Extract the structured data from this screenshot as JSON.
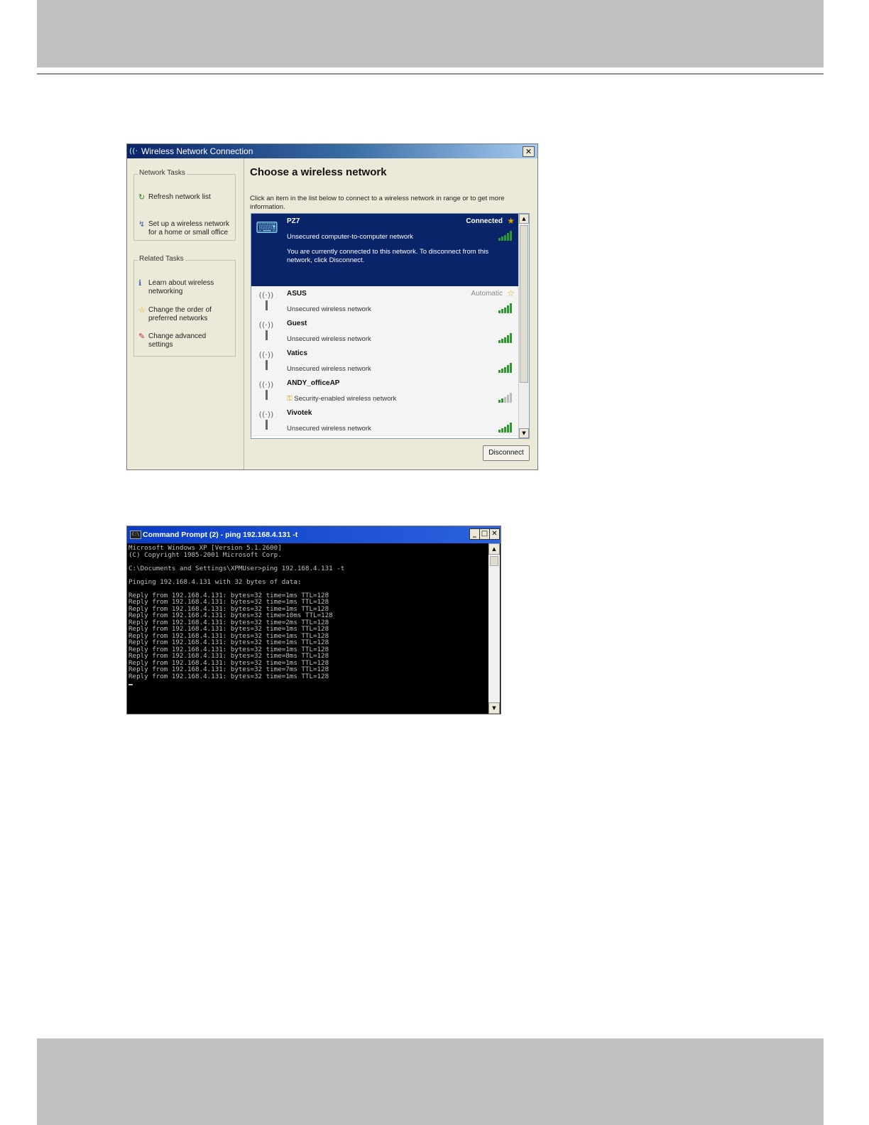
{
  "wireless": {
    "title": "Wireless Network Connection",
    "close_glyph": "✕",
    "network_tasks": {
      "title": "Network Tasks",
      "items": [
        {
          "label": "Refresh network list",
          "icon": "refresh-icon"
        },
        {
          "label": "Set up a wireless network for a home or small office",
          "icon": "setup-network-icon"
        }
      ]
    },
    "related_tasks": {
      "title": "Related Tasks",
      "items": [
        {
          "label": "Learn about wireless networking",
          "icon": "info-icon"
        },
        {
          "label": "Change the order of preferred networks",
          "icon": "star-icon"
        },
        {
          "label": "Change advanced settings",
          "icon": "settings-icon"
        }
      ]
    },
    "heading": "Choose a wireless network",
    "description": "Click an item in the list below to connect to a wireless network in range or to get more information.",
    "networks": [
      {
        "name": "PZ7",
        "type": "Unsecured computer-to-computer network",
        "status": "Connected",
        "starred": true,
        "signal": 5,
        "selected": true,
        "message": "You are currently connected to this network. To disconnect from this network, click Disconnect."
      },
      {
        "name": "ASUS",
        "type": "Unsecured wireless network",
        "status": "Automatic",
        "starred": true,
        "signal": 5
      },
      {
        "name": "Guest",
        "type": "Unsecured wireless network",
        "signal": 5
      },
      {
        "name": "Vatics",
        "type": "Unsecured wireless network",
        "signal": 5
      },
      {
        "name": "ANDY_officeAP",
        "type": "Security-enabled wireless network",
        "signal": 2,
        "secured": true
      },
      {
        "name": "Vivotek",
        "type": "Unsecured wireless network",
        "signal": 5
      }
    ],
    "disconnect_label": "Disconnect",
    "colors": {
      "selected_bg": "#0a246a",
      "signal_on": "#2e9a2e",
      "star": "#d6a800"
    }
  },
  "cmd": {
    "title": "Command Prompt (2) - ping 192.168.4.131 -t",
    "lines": [
      "Microsoft Windows XP [Version 5.1.2600]",
      "(C) Copyright 1985-2001 Microsoft Corp.",
      "",
      "C:\\Documents and Settings\\XPMUser>ping 192.168.4.131 -t",
      "",
      "Pinging 192.168.4.131 with 32 bytes of data:",
      "",
      "Reply from 192.168.4.131: bytes=32 time=1ms TTL=128",
      "Reply from 192.168.4.131: bytes=32 time=1ms TTL=128",
      "Reply from 192.168.4.131: bytes=32 time=1ms TTL=128",
      "Reply from 192.168.4.131: bytes=32 time=10ms TTL=128",
      "Reply from 192.168.4.131: bytes=32 time=2ms TTL=128",
      "Reply from 192.168.4.131: bytes=32 time=1ms TTL=128",
      "Reply from 192.168.4.131: bytes=32 time=1ms TTL=128",
      "Reply from 192.168.4.131: bytes=32 time=1ms TTL=128",
      "Reply from 192.168.4.131: bytes=32 time=1ms TTL=128",
      "Reply from 192.168.4.131: bytes=32 time=8ms TTL=128",
      "Reply from 192.168.4.131: bytes=32 time=1ms TTL=128",
      "Reply from 192.168.4.131: bytes=32 time=7ms TTL=128",
      "Reply from 192.168.4.131: bytes=32 time=1ms TTL=128"
    ],
    "controls": {
      "minimize": "_",
      "maximize": "□",
      "close": "✕"
    }
  }
}
